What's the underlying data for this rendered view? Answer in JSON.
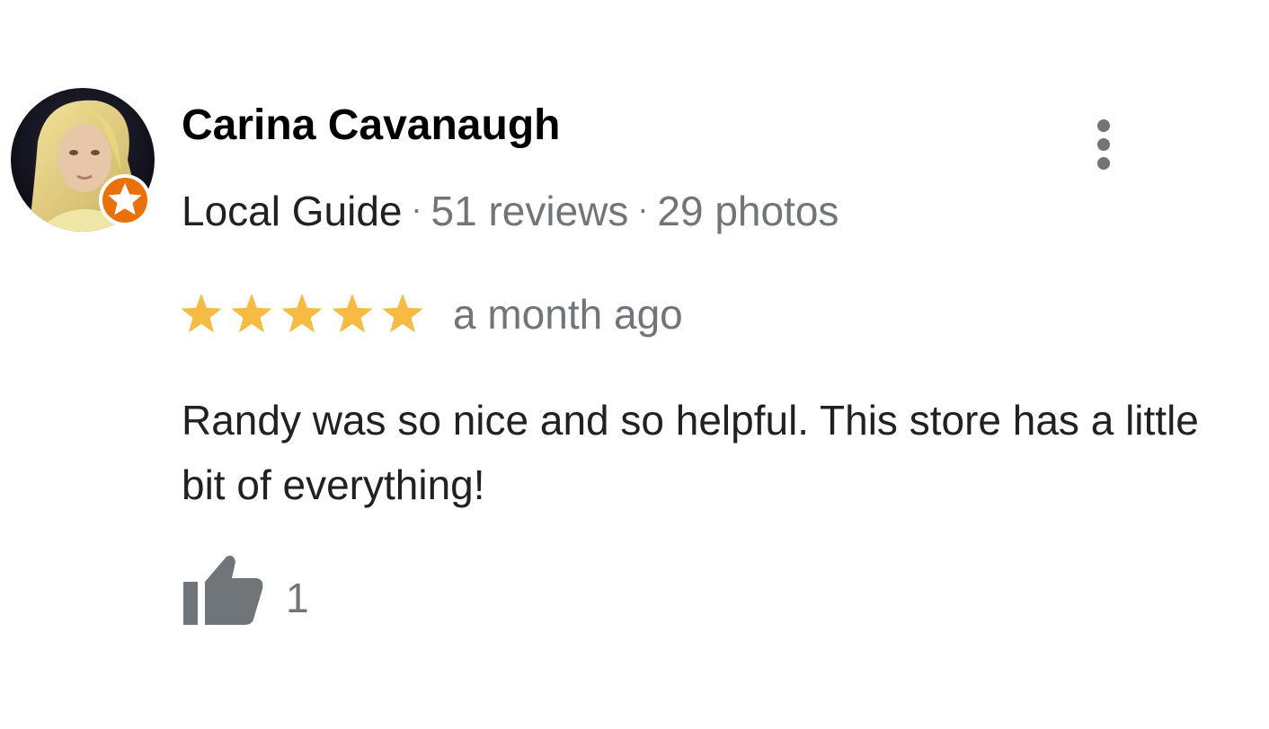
{
  "reviewer": {
    "name": "Carina Cavanaugh",
    "badge": "Local Guide",
    "separator": "·",
    "reviews": "51 reviews",
    "photos": "29 photos",
    "avatar_icon": "avatar-photo",
    "badge_icon": "local-guide-star-badge"
  },
  "review": {
    "rating": 5,
    "rating_max": 5,
    "date": "a month ago",
    "text": "Randy was so nice and so helpful. This store has a little bit of everything!"
  },
  "actions": {
    "more_icon": "more-vertical-icon",
    "like_icon": "thumbs-up-icon",
    "like_count": "1"
  },
  "colors": {
    "star": "#f6bb42",
    "badge": "#e8710a",
    "meta_text": "#70757a",
    "primary_text": "#202124",
    "icon": "#70757a"
  }
}
